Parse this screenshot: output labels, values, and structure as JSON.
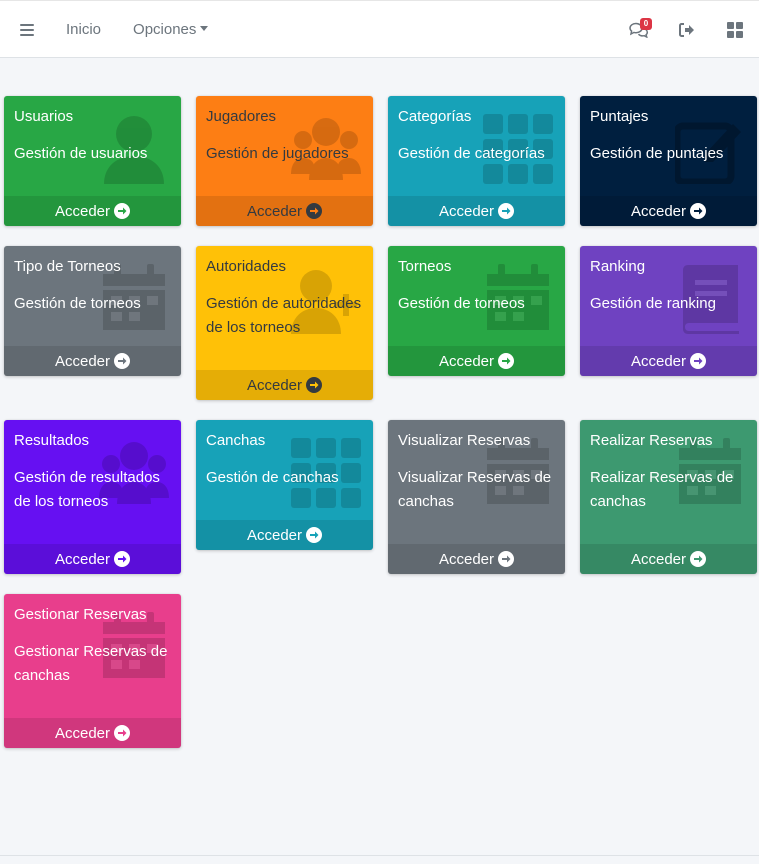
{
  "nav": {
    "inicio": "Inicio",
    "opciones": "Opciones",
    "notifications_count": "0"
  },
  "colors": {
    "green": "#28a745",
    "orange": "#fd7e14",
    "teal": "#17a2b8",
    "navy": "#001f3f",
    "gray": "#6c757d",
    "yellow": "#ffc107",
    "purple": "#6f42c1",
    "indigo": "#6610f2",
    "success_dark": "#3d9970",
    "pink": "#e83e8c"
  },
  "cards": [
    {
      "title": "Usuarios",
      "desc": "Gestión de usuarios",
      "link": "Acceder",
      "color": "#28a745",
      "icon": "user-icon"
    },
    {
      "title": "Jugadores",
      "desc": "Gestión de jugadores",
      "link": "Acceder",
      "color": "#fd7e14",
      "icon": "users-icon"
    },
    {
      "title": "Categorías",
      "desc": "Gestión de categorías",
      "link": "Acceder",
      "color": "#17a2b8",
      "icon": "grid-icon"
    },
    {
      "title": "Puntajes",
      "desc": "Gestión de puntajes",
      "link": "Acceder",
      "color": "#001f3f",
      "icon": "edit-icon"
    },
    {
      "title": "Tipo de Torneos",
      "desc": "Gestión de torneos",
      "link": "Acceder",
      "color": "#6c757d",
      "icon": "calendar-icon"
    },
    {
      "title": "Autoridades",
      "desc": "Gestión de autoridades de los torneos",
      "link": "Acceder",
      "color": "#ffc107",
      "icon": "user-plus-icon"
    },
    {
      "title": "Torneos",
      "desc": "Gestión de torneos",
      "link": "Acceder",
      "color": "#28a745",
      "icon": "calendar-icon"
    },
    {
      "title": "Ranking",
      "desc": "Gestión de ranking",
      "link": "Acceder",
      "color": "#6f42c1",
      "icon": "book-icon"
    },
    {
      "title": "Resultados",
      "desc": "Gestión de resultados de los torneos",
      "link": "Acceder",
      "color": "#6610f2",
      "icon": "users-icon"
    },
    {
      "title": "Canchas",
      "desc": "Gestión de canchas",
      "link": "Acceder",
      "color": "#17a2b8",
      "icon": "grid-icon"
    },
    {
      "title": "Visualizar Reservas",
      "desc": "Visualizar Reservas de canchas",
      "link": "Acceder",
      "color": "#6c757d",
      "icon": "calendar-icon"
    },
    {
      "title": "Realizar Reservas",
      "desc": "Realizar Reservas de canchas",
      "link": "Acceder",
      "color": "#3d9970",
      "icon": "calendar-icon"
    },
    {
      "title": "Gestionar Reservas",
      "desc": "Gestionar Reservas de canchas",
      "link": "Acceder",
      "color": "#e83e8c",
      "icon": "calendar-icon"
    }
  ]
}
